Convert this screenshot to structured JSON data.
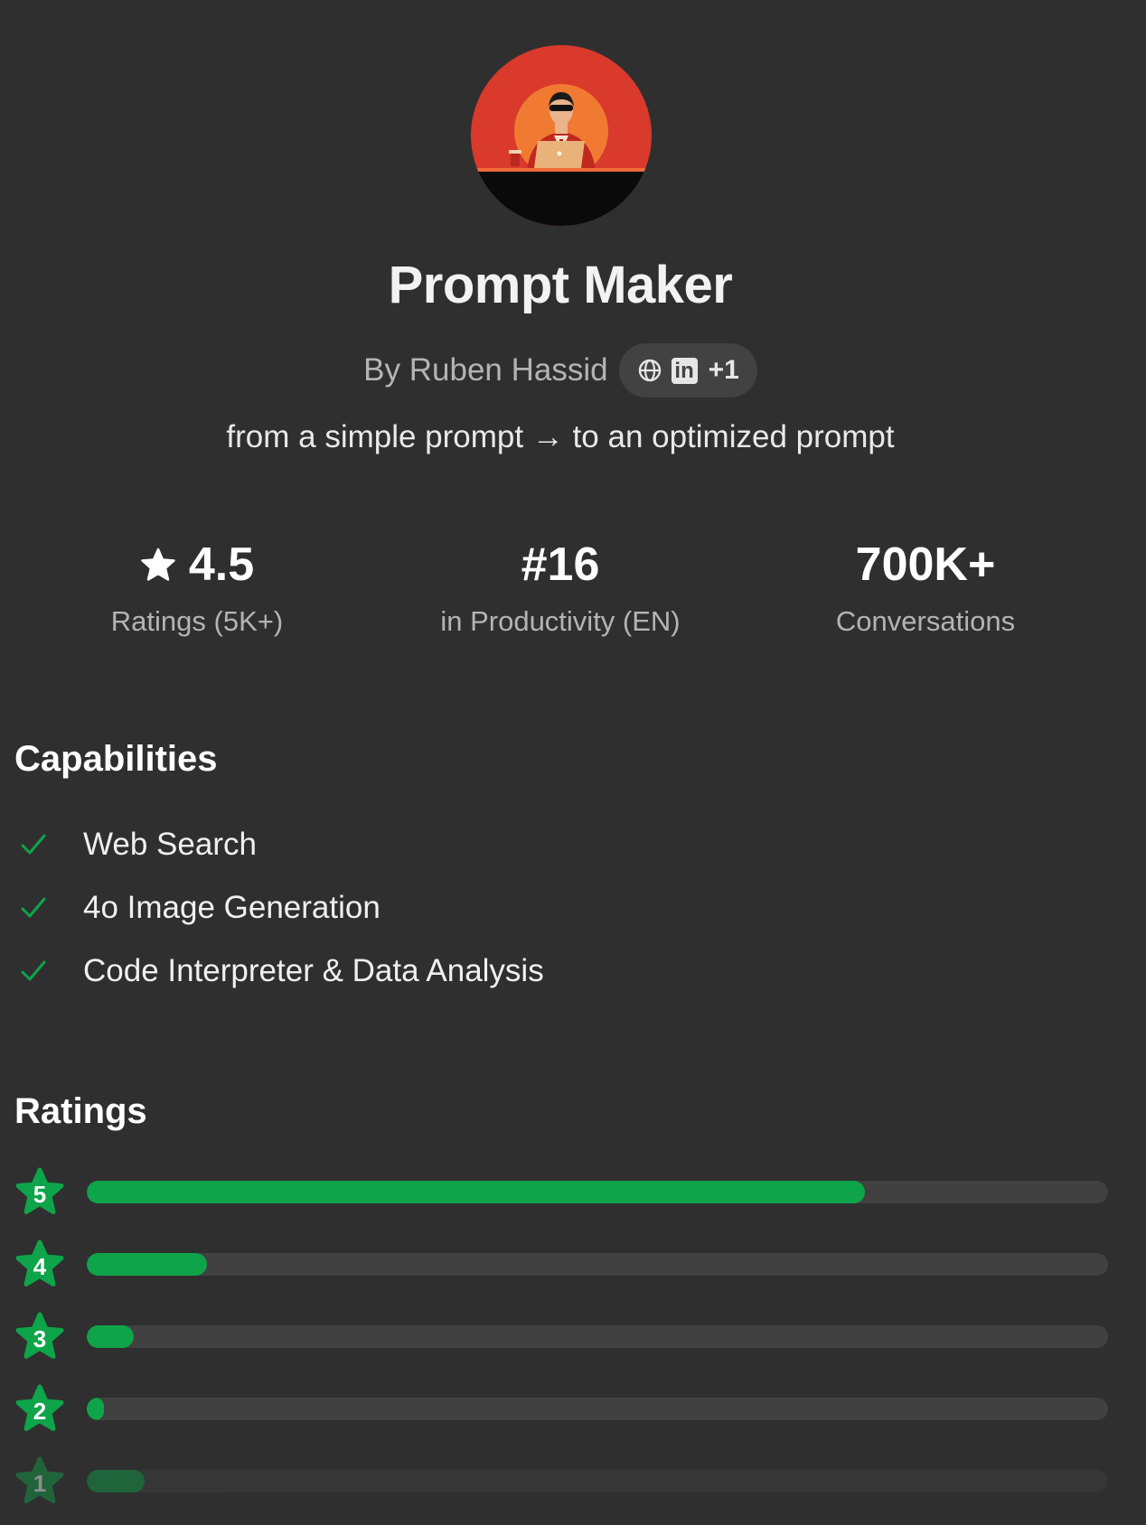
{
  "gpt": {
    "name": "Prompt Maker",
    "author": "By Ruben Hassid",
    "links": {
      "icons": [
        "globe-icon",
        "linkedin-icon"
      ],
      "linkedin_glyph": "in",
      "more": "+1"
    },
    "tagline": "from a simple prompt → to an optimized prompt"
  },
  "stats": [
    {
      "value": "4.5",
      "label": "Ratings (5K+)",
      "icon": "star-icon"
    },
    {
      "value": "#16",
      "label": "in Productivity (EN)"
    },
    {
      "value": "700K+",
      "label": "Conversations"
    }
  ],
  "capabilities": {
    "title": "Capabilities",
    "items": [
      "Web Search",
      "4o Image Generation",
      "Code Interpreter & Data Analysis"
    ]
  },
  "ratings": {
    "title": "Ratings",
    "rows": [
      {
        "stars": "5",
        "fraction": 0.762
      },
      {
        "stars": "4",
        "fraction": 0.118
      },
      {
        "stars": "3",
        "fraction": 0.046
      },
      {
        "stars": "2",
        "fraction": 0.017
      },
      {
        "stars": "1",
        "fraction": 0.057
      }
    ]
  },
  "colors": {
    "background": "#2f2f2f",
    "accent_green": "#0ea44a",
    "pill": "#424242",
    "track": "#414141"
  }
}
